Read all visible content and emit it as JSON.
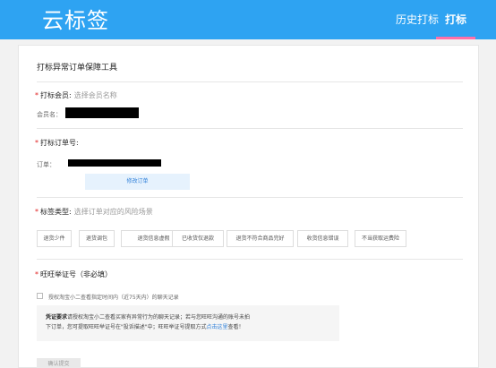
{
  "header": {
    "app_title": "云标签",
    "nav": {
      "history": "历史打标",
      "print": "打标"
    }
  },
  "card": {
    "title": "打标异常订单保障工具",
    "member": {
      "title": "打标会员:",
      "hint": "选择会员名称",
      "name_label": "会员名："
    },
    "order": {
      "title": "打标订单号:",
      "order_label": "订单：",
      "modify_button": "修改订单"
    },
    "tags_section": {
      "title": "标签类型:",
      "hint": "选择订单对应的风险场景",
      "tags": [
        "退货少件",
        "退货调包",
        "退货信息虚假",
        "已收货仅退款",
        "退货不符合商品完好",
        "收货信息错误",
        "不当获取运费险"
      ]
    },
    "wangwang": {
      "title": "旺旺举证号（非必填）",
      "checkbox_label": "授权淘宝小二查看指定时间内（近75天内）的聊天记录",
      "note_title": "凭证要求",
      "note_line1": "请授权淘宝小二查看买家有异常行为的聊天记录；若与您旺旺沟通的账号未拍",
      "note_line2a": "下订单，您可提取旺旺举证号在\"投诉描述\"中；旺旺举证号提取方式",
      "note_link": "点击这里",
      "note_line2b": "查看！"
    },
    "submit_button": "确认提交"
  }
}
